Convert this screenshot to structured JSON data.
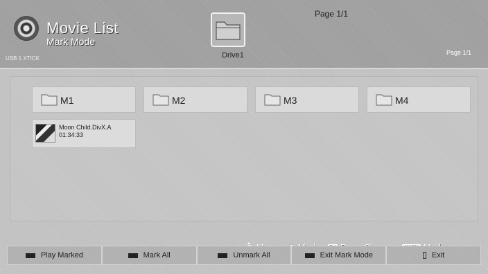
{
  "header": {
    "title": "Movie List",
    "subtitle": "Mark Mode",
    "source_label": "USB 1 XTICK",
    "drive_label": "Drive1",
    "page_top": "Page 1/1",
    "page_right": "Page 1/1",
    "icon": "movie-reel-icon"
  },
  "folders": [
    {
      "label": "M1",
      "icon": "folder-icon"
    },
    {
      "label": "M2",
      "icon": "folder-icon"
    },
    {
      "label": "M3",
      "icon": "folder-icon"
    },
    {
      "label": "M4",
      "icon": "folder-icon"
    }
  ],
  "files": [
    {
      "name": "Moon Child.DivX.A",
      "duration": "01:34:33",
      "icon": "movie-thumbnail"
    }
  ],
  "legend": {
    "move": "Move",
    "mark": "Mark",
    "page_change": "Page Change",
    "ch_key": "CH",
    "mark_key": "MARK",
    "mark2": "Mark"
  },
  "buttons": {
    "play_marked": "Play Marked",
    "mark_all": "Mark All",
    "unmark_all": "Unmark All",
    "exit_mark_mode": "Exit Mark Mode",
    "exit": "Exit"
  }
}
